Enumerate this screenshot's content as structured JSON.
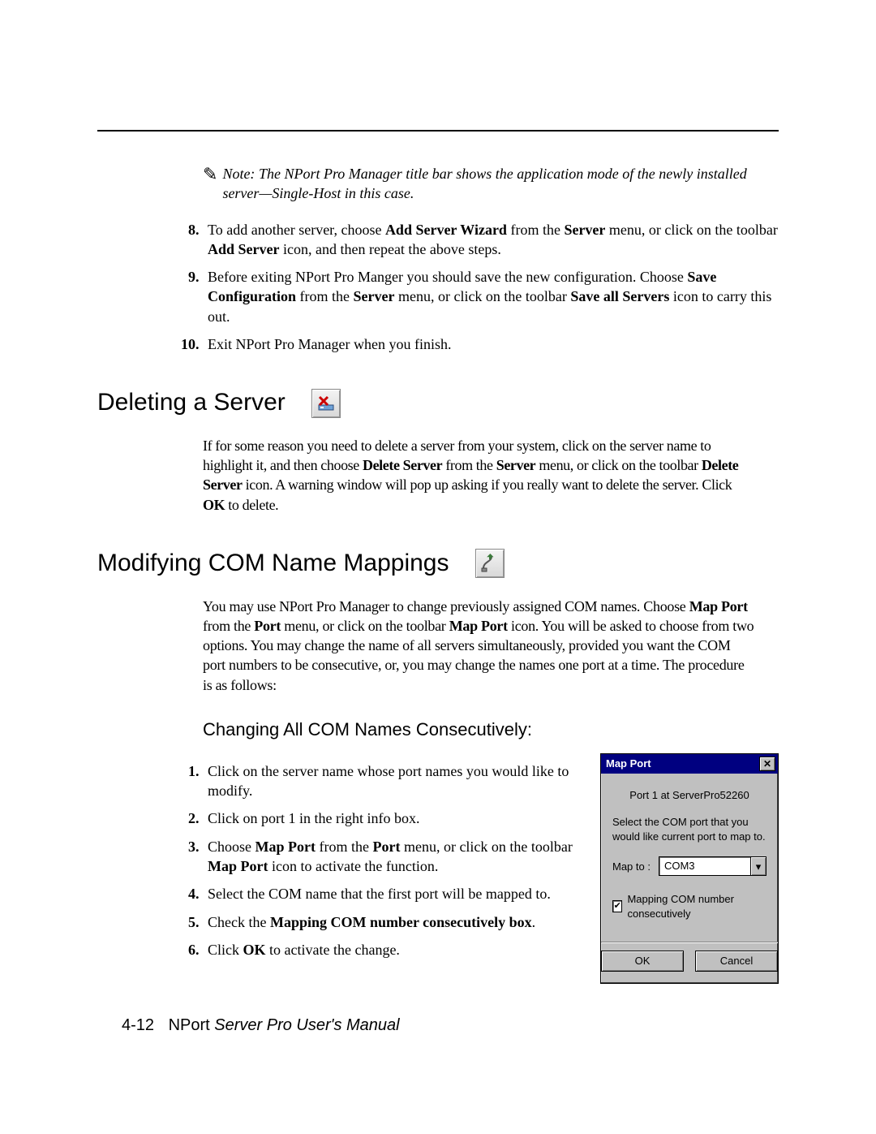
{
  "note": {
    "prefix": "Note:",
    "text": "The NPort Pro Manager title bar shows the application mode of the newly installed server—Single-Host in this case."
  },
  "top_list": {
    "start": 8,
    "items": [
      {
        "pre": "To add another server, choose ",
        "b1": "Add Server Wizard",
        "mid1": " from the ",
        "b2": "Server",
        "mid2": " menu, or click on the toolbar ",
        "b3": "Add Server",
        "post": " icon, and then repeat the above steps."
      },
      {
        "pre": "Before exiting NPort Pro Manger you should save the new configuration. Choose ",
        "b1": "Save Configuration",
        "mid1": " from the ",
        "b2": "Server",
        "mid2": " menu, or click on the toolbar ",
        "b3": "Save all Servers",
        "post": " icon to carry this out."
      },
      {
        "plain": "Exit NPort Pro Manager when you finish."
      }
    ]
  },
  "deleting": {
    "heading": "Deleting a Server",
    "para": {
      "t1": "If for some reason you need to delete a server from your system, click on the server name to highlight it, and then choose ",
      "b1": "Delete Server",
      "t2": " from the ",
      "b2": "Server",
      "t3": " menu, or click on the toolbar ",
      "b3": "Delete Server",
      "t4": " icon. A warning window will pop up asking if you really want to delete the server. Click ",
      "b4": "OK",
      "t5": " to delete."
    }
  },
  "modifying": {
    "heading": "Modifying COM Name Mappings",
    "para": {
      "t1": "You may use NPort Pro Manager to change previously assigned COM names. Choose ",
      "b1": "Map Port",
      "t2": " from the ",
      "b2": "Port",
      "t3": " menu, or click on the toolbar ",
      "b3": "Map Port",
      "t4": " icon. You will be asked to choose from two options. You may change the name of all servers simultaneously, provided you want the COM port numbers to be consecutive, or, you may change the names one port at a time. The procedure is as follows:"
    }
  },
  "changing": {
    "heading": "Changing All COM Names Consecutively:",
    "items": [
      {
        "plain": "Click on the server name whose port names you would like to modify."
      },
      {
        "plain": "Click on port 1 in the right info box."
      },
      {
        "pre": "Choose ",
        "b1": "Map Port",
        "mid1": " from the ",
        "b2": "Port",
        "mid2": " menu, or click on the toolbar ",
        "b3": "Map Port",
        "post": " icon to activate the function."
      },
      {
        "plain": "Select the COM name that the first port will be mapped to."
      },
      {
        "pre": "Check the ",
        "b1": "Mapping COM number consecutively box",
        "post": "."
      },
      {
        "pre": "Click ",
        "b1": "OK",
        "post": " to activate the change."
      }
    ]
  },
  "dialog": {
    "title": "Map Port",
    "port_line": "Port 1 at ServerPro52260",
    "instr": "Select the COM port that you would like current port to map to.",
    "mapto_label": "Map to :",
    "mapto_value": "COM3",
    "checkbox_checked": true,
    "checkbox_label": "Mapping COM number consecutively",
    "ok": "OK",
    "cancel": "Cancel"
  },
  "footer": {
    "page_num": "4-12",
    "title_prefix": "NPort ",
    "title_rest": "Server Pro User's Manual"
  }
}
